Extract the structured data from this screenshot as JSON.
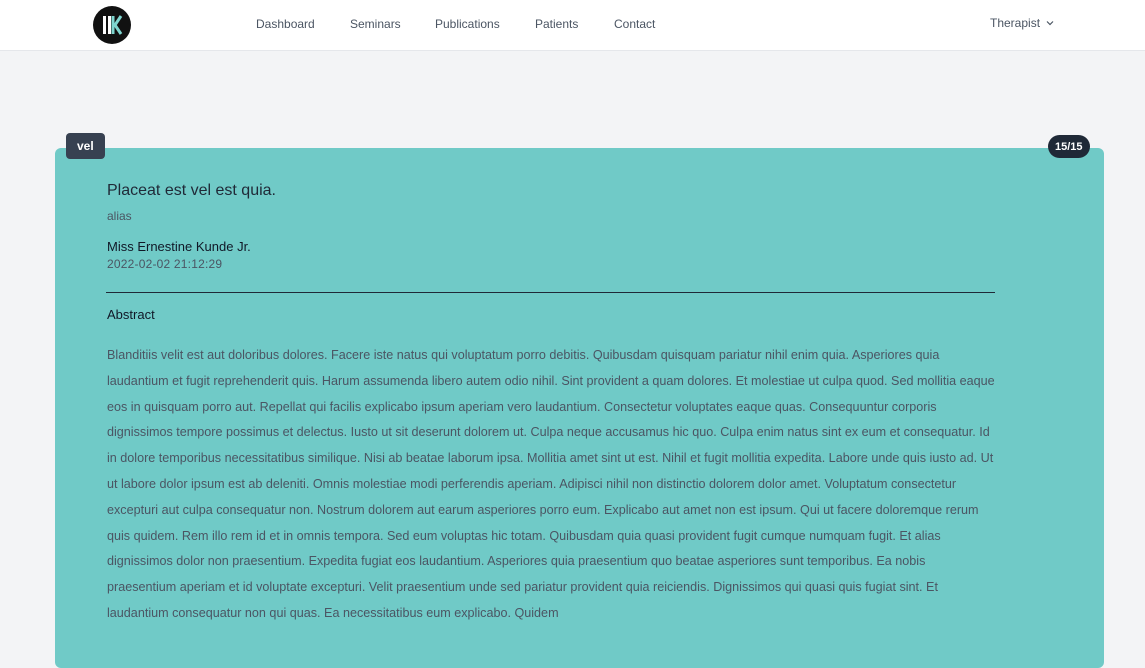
{
  "nav": {
    "items": [
      "Dashboard",
      "Seminars",
      "Publications",
      "Patients",
      "Contact"
    ],
    "user_label": "Therapist"
  },
  "publication": {
    "tag": "vel",
    "counter": "15/15",
    "title": "Placeat est vel est quia.",
    "subtitle": "alias",
    "author": "Miss Ernestine Kunde Jr.",
    "date": "2022-02-02 21:12:29",
    "abstract_heading": "Abstract",
    "abstract": "Blanditiis velit est aut doloribus dolores. Facere iste natus qui voluptatum porro debitis. Quibusdam quisquam pariatur nihil enim quia. Asperiores quia laudantium et fugit reprehenderit quis. Harum assumenda libero autem odio nihil. Sint provident a quam dolores. Et molestiae ut culpa quod. Sed mollitia eaque eos in quisquam porro aut. Repellat qui facilis explicabo ipsum aperiam vero laudantium. Consectetur voluptates eaque quas. Consequuntur corporis dignissimos tempore possimus et delectus. Iusto ut sit deserunt dolorem ut. Culpa neque accusamus hic quo. Culpa enim natus sint ex eum et consequatur. Id in dolore temporibus necessitatibus similique. Nisi ab beatae laborum ipsa. Mollitia amet sint ut est. Nihil et fugit mollitia expedita. Labore unde quis iusto ad. Ut ut labore dolor ipsum est ab deleniti. Omnis molestiae modi perferendis aperiam. Adipisci nihil non distinctio dolorem dolor amet. Voluptatum consectetur excepturi aut culpa consequatur non. Nostrum dolorem aut earum asperiores porro eum. Explicabo aut amet non est ipsum. Qui ut facere doloremque rerum quis quidem. Rem illo rem id et in omnis tempora. Sed eum voluptas hic totam. Quibusdam quia quasi provident fugit cumque numquam fugit. Et alias dignissimos dolor non praesentium. Expedita fugiat eos laudantium. Asperiores quia praesentium quo beatae asperiores sunt temporibus. Ea nobis praesentium aperiam et id voluptate excepturi. Velit praesentium unde sed pariatur provident quia reiciendis. Dignissimos qui quasi quis fugiat sint. Et laudantium consequatur non qui quas. Ea necessitatibus eum explicabo. Quidem"
  },
  "colors": {
    "card_background": "#70cac7",
    "badge_dark": "#374151",
    "page_background": "#f3f4f6"
  }
}
